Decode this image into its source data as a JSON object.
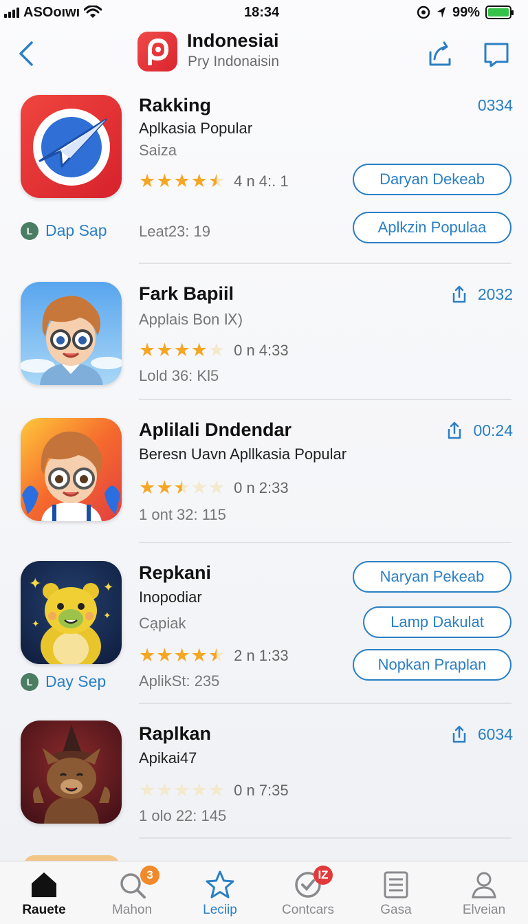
{
  "status": {
    "carrier": "ASOoıwı",
    "time": "18:34",
    "battery": "99%"
  },
  "header": {
    "title": "Indonesiai",
    "subtitle": "Pry Indonaisin"
  },
  "items": [
    {
      "name": "Rakking",
      "subtitle": "Aplkasia Popular",
      "category": "Saiza",
      "rating": 4.5,
      "rating_text": "4 n 4:. 1",
      "meta": "Leat23: 19",
      "count": "0334",
      "buttons": [
        "Daryan Dekeab",
        "Aplkzin Populaa"
      ],
      "tag": "Dap Sap"
    },
    {
      "name": "Fark Bapiil",
      "subtitle": "Applais Bon Ⅸ)",
      "rating": 4,
      "rating_text": "0 n 4:33",
      "meta": "Lold 36: Kl5",
      "count": "2032"
    },
    {
      "name": "Aplilali Dndendar",
      "subtitle": "Beresn Uavn  Apllkasia Popular",
      "rating": 2.5,
      "rating_text": "0 n 2:33",
      "meta": "1 ont 32: 115",
      "count": "00:24"
    },
    {
      "name": "Repkani",
      "subtitle": "Inopodiar",
      "category": "Cạpiak",
      "rating": 4.5,
      "rating_text": "2 n 1:33",
      "meta": "AplikSt: 235",
      "buttons": [
        "Naryan Pekeab",
        "Lamp Dakulat",
        "Nopkan Praplan"
      ],
      "tag": "Day Sep"
    },
    {
      "name": "Raplkan",
      "subtitle": "Apikai47",
      "rating": 0,
      "rating_text": "0 n 7:35",
      "meta": "1 olo 22: 145",
      "count": "6034"
    }
  ],
  "tabs": [
    {
      "label": "Rauete",
      "icon": "home-icon"
    },
    {
      "label": "Mahon",
      "icon": "search-icon",
      "badge": "3"
    },
    {
      "label": "Leciip",
      "icon": "star-icon"
    },
    {
      "label": "Contcars",
      "icon": "chat-icon",
      "badge": "IZ"
    },
    {
      "label": "Gasa",
      "icon": "list-icon"
    },
    {
      "label": "Elveian",
      "icon": "person-icon"
    }
  ],
  "colors": {
    "accent": "#2b7fc4",
    "star": "#f5a623",
    "badge": "#e7512a"
  }
}
